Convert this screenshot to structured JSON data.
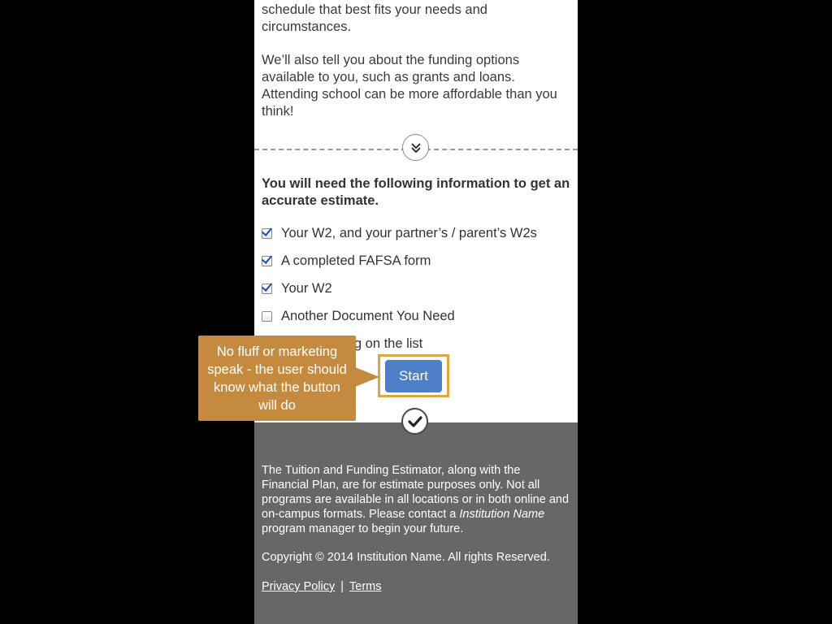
{
  "intro": {
    "paragraph1": "through school. You can pick the course and schedule that best fits your needs and circumstances.",
    "paragraph2": "We’ll also tell you about the funding options available to you, such as grants and loans. Attending school can be more affordable than you think!"
  },
  "divider": {
    "icon": "double-chevron-down-icon"
  },
  "requirements": {
    "heading": "You will need the following information to get an accurate estimate.",
    "items": [
      {
        "label": "Your W2, and your partner’s / parent’s W2s",
        "checked": true
      },
      {
        "label": "A completed FAFSA form",
        "checked": true
      },
      {
        "label": "Your W2",
        "checked": true
      },
      {
        "label": "Another Document You Need",
        "checked": false
      },
      {
        "label": "The last thing on the list",
        "checked": false
      }
    ]
  },
  "start_button": {
    "label": "Start"
  },
  "callout": {
    "text": "No fluff or marketing speak - the user should know what the button will do"
  },
  "footer": {
    "icon": "checkmark-icon",
    "disclaimer_before": "The Tuition and Funding Estimator, along with the Financial Plan, are for estimate purposes only. Not all programs are available in all locations or in both online and on-campus formats. Please contact a ",
    "disclaimer_italic": "Institution Name",
    "disclaimer_after": " program manager to begin your future.",
    "copyright": "Copyright © 2014 Institution Name. All rights Reserved.",
    "privacy_link": "Privacy Policy",
    "separator": "|",
    "terms_link": "Terms"
  },
  "colors": {
    "button": "#4f7fc6",
    "callout": "#c48a3f",
    "highlight_border": "#e1a641",
    "footer_bg": "#676767"
  }
}
